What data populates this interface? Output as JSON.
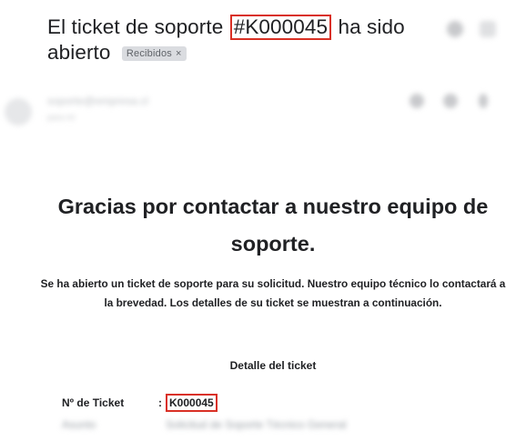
{
  "email": {
    "subject_before": "El ticket de soporte ",
    "subject_highlight": "#K000045",
    "subject_after": " ha sido abierto",
    "label_chip": "Recibidos",
    "label_chip_close": "×",
    "sender_name_blurred": "soporte@empresa.cl",
    "sender_date_blurred": "para mí"
  },
  "body": {
    "heading": "Gracias por contactar a nuestro equipo de soporte.",
    "intro": "Se ha abierto un ticket de soporte para su solicitud. Nuestro equipo técnico lo contactará a la brevedad. Los detalles de su ticket se muestran a continuación.",
    "detail_title": "Detalle del ticket",
    "ticket_label": "Nº de Ticket",
    "separator": ":",
    "ticket_value": "K000045",
    "row2_label_blurred": "Asunto",
    "row2_value_blurred": "Solicitud de Soporte Técnico General"
  },
  "colors": {
    "highlight_box": "#d93025",
    "chip_bg": "#dadce0"
  }
}
